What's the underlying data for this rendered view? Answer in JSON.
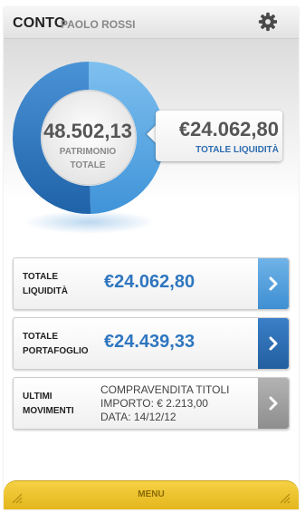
{
  "header": {
    "title": "CONTO",
    "user": "PAOLO ROSSI",
    "settings_icon": "gear-icon"
  },
  "summary": {
    "total_value": "48.502,13",
    "total_label_line1": "PATRIMONIO",
    "total_label_line2": "TOTALE",
    "liquidity_fraction": 0.496,
    "callout_amount": "€24.062,80",
    "callout_label": "TOTALE LIQUIDITÀ"
  },
  "cards": [
    {
      "label_line1": "TOTALE",
      "label_line2": "LIQUIDITÀ",
      "value": "€24.062,80",
      "icon": "chevron-right-icon"
    },
    {
      "label_line1": "TOTALE",
      "label_line2": "PORTAFOGLIO",
      "value": "€24.439,33",
      "icon": "chevron-right-icon"
    },
    {
      "label_line1": "ULTIMI",
      "label_line2": "MOVIMENTI",
      "line1": "COMPRAVENDITA TITOLI",
      "line2": "IMPORTO: € 2.213,00",
      "line3": "DATA: 14/12/12",
      "icon": "chevron-right-icon"
    }
  ],
  "menu": {
    "label": "MENU"
  },
  "colors": {
    "accent_blue": "#3b8fd8",
    "dark_blue": "#2a6db3",
    "menu_yellow": "#f2c631"
  }
}
